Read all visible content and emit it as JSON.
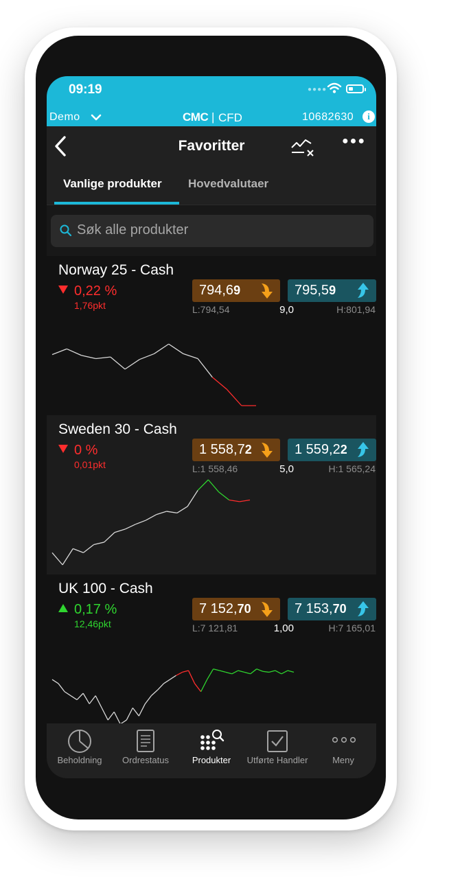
{
  "status": {
    "time": "09:19"
  },
  "account": {
    "mode": "Demo",
    "brand": "CMC",
    "separator": "|",
    "product": "CFD",
    "number": "10682630"
  },
  "header": {
    "title": "Favoritter"
  },
  "tabs": [
    {
      "label": "Vanlige produkter",
      "active": true
    },
    {
      "label": "Hovedvalutaer",
      "active": false
    }
  ],
  "search": {
    "placeholder": "Søk alle produkter",
    "value": ""
  },
  "products": [
    {
      "name": "Norway 25 - Cash",
      "direction": "down",
      "change_pct": "0,22 %",
      "change_pts": "1,76pkt",
      "sell": {
        "main": "794,6",
        "tail": "9"
      },
      "buy": {
        "main": "795,5",
        "tail": "9"
      },
      "low": "L:794,54",
      "spread": "9,0",
      "high": "H:801,94",
      "spark": [
        0.63,
        0.7,
        0.62,
        0.58,
        0.6,
        0.45,
        0.57,
        0.64,
        0.76,
        0.64,
        0.58,
        0.35,
        0.2,
        0.0,
        0.0
      ],
      "spark_red_from": 11
    },
    {
      "name": "Sweden 30 - Cash",
      "direction": "down",
      "change_pct": "0 %",
      "change_pts": "0,01pkt",
      "sell": {
        "main": "1 558,7",
        "tail": "2"
      },
      "buy": {
        "main": "1 559,2",
        "tail": "2"
      },
      "low": "L:1 558,46",
      "spread": "5,0",
      "high": "H:1 565,24",
      "spark": [
        0.15,
        0.0,
        0.2,
        0.15,
        0.25,
        0.28,
        0.4,
        0.44,
        0.5,
        0.55,
        0.62,
        0.66,
        0.64,
        0.72,
        0.92,
        1.05,
        0.9,
        0.8,
        0.78,
        0.8
      ],
      "spark_green_from": 14,
      "spark_red_from": 17
    },
    {
      "name": "UK 100 - Cash",
      "direction": "up",
      "change_pct": "0,17 %",
      "change_pts": "12,46pkt",
      "sell": {
        "main": "7 152,",
        "tail": "70"
      },
      "buy": {
        "main": "7 153,",
        "tail": "70"
      },
      "low": "L:7 121,81",
      "spread": "1,00",
      "high": "H:7 165,01",
      "spark": [
        0.55,
        0.5,
        0.4,
        0.35,
        0.3,
        0.38,
        0.25,
        0.35,
        0.2,
        0.05,
        0.15,
        0.0,
        0.05,
        0.2,
        0.1,
        0.25,
        0.35,
        0.42,
        0.5,
        0.55,
        0.6,
        0.64,
        0.66,
        0.5,
        0.4,
        0.55,
        0.68,
        0.66,
        0.64,
        0.62,
        0.66,
        0.64,
        0.62,
        0.68,
        0.65,
        0.64,
        0.66,
        0.62,
        0.66,
        0.64
      ],
      "spark_red_from": 20,
      "spark_green_from": 24
    }
  ],
  "nav": [
    {
      "label": "Beholdning",
      "icon": "pie-chart-icon",
      "active": false
    },
    {
      "label": "Ordrestatus",
      "icon": "document-icon",
      "active": false
    },
    {
      "label": "Produkter",
      "icon": "products-search-icon",
      "active": true
    },
    {
      "label": "Utførte Handler",
      "icon": "checkbox-icon",
      "active": false
    },
    {
      "label": "Meny",
      "icon": "more-dots-icon",
      "active": false
    }
  ],
  "colors": {
    "accent": "#1cb8d8",
    "sell": "#6b3f12",
    "buy": "#1a5560",
    "sell_arrow": "#f5a01a",
    "buy_arrow": "#37c5e8",
    "negative": "#ff2d2d",
    "positive": "#2fd52f"
  }
}
